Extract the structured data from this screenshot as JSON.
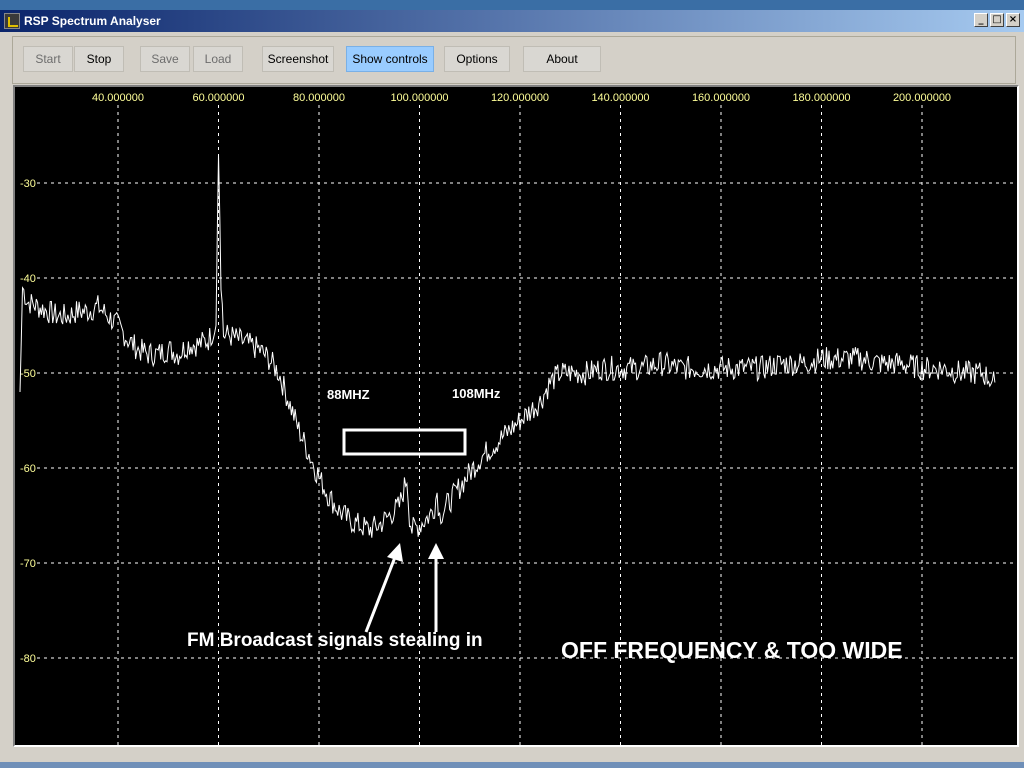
{
  "window": {
    "title": "RSP Spectrum Analyser",
    "controls": [
      "_",
      "□",
      "×"
    ]
  },
  "toolbar": {
    "buttons": [
      {
        "label": "Start",
        "enabled": false
      },
      {
        "label": "Stop",
        "enabled": true
      },
      {
        "label": "Save",
        "enabled": false
      },
      {
        "label": "Load",
        "enabled": false
      },
      {
        "label": "Screenshot",
        "enabled": true
      },
      {
        "label": "Show controls",
        "enabled": true,
        "active": true
      },
      {
        "label": "Options",
        "enabled": true
      },
      {
        "label": "About",
        "enabled": true
      }
    ]
  },
  "colors": {
    "plot_background": "#000000",
    "trace": "#ffffff",
    "axis_labels": "#ffff99",
    "grid": "#ffffff",
    "toolbar_active": "#99ccff"
  },
  "chart_data": {
    "type": "line",
    "title": "",
    "xlabel": "",
    "ylabel": "",
    "xlim": [
      20,
      215
    ],
    "ylim": [
      -90,
      -20
    ],
    "x_ticks": [
      40,
      60,
      80,
      100,
      120,
      140,
      160,
      180,
      200
    ],
    "x_tick_labels": [
      "40.000000",
      "60.000000",
      "80.000000",
      "100.000000",
      "120.000000",
      "140.000000",
      "160.000000",
      "180.000000",
      "200.000000"
    ],
    "y_ticks": [
      -30,
      -40,
      -50,
      -60,
      -70,
      -80
    ],
    "y_tick_labels": [
      "-30",
      "-40",
      "-50",
      "-60",
      "-70",
      "-80"
    ],
    "grid": true,
    "series": [
      {
        "x": [
          20.5,
          21,
          22,
          24,
          26,
          28,
          30,
          32,
          34,
          36,
          38,
          40,
          42,
          44,
          46,
          48,
          50,
          52,
          54,
          56,
          58,
          59.5,
          60,
          60.5,
          61,
          62,
          64,
          66,
          68,
          70,
          72,
          74,
          76,
          78,
          80,
          82,
          84,
          86,
          88,
          90,
          92,
          94,
          96,
          97.5,
          98,
          98.5,
          100,
          102,
          103,
          103.5,
          104,
          106,
          108,
          110,
          112,
          114,
          116,
          118,
          120,
          122,
          124,
          126,
          128,
          130,
          132,
          133,
          133.5,
          136,
          140,
          144,
          148,
          152,
          156,
          160,
          164,
          168,
          172,
          176,
          180,
          184,
          188,
          192,
          196,
          200,
          204,
          208,
          212,
          214.5
        ],
        "values": [
          -52,
          -41,
          -42.5,
          -43,
          -43.5,
          -44,
          -44,
          -43.5,
          -43.5,
          -43,
          -44,
          -45,
          -46.5,
          -47.5,
          -48,
          -48,
          -47.5,
          -48,
          -47,
          -47,
          -46.5,
          -45,
          -27,
          -40,
          -46,
          -46,
          -46.5,
          -47,
          -47.5,
          -48.5,
          -50,
          -53,
          -56,
          -58.5,
          -61,
          -63,
          -64.5,
          -65.5,
          -66,
          -66.5,
          -66,
          -65,
          -64,
          -61,
          -65,
          -66.5,
          -66,
          -65,
          -64,
          -62.5,
          -65,
          -63.5,
          -62,
          -60.5,
          -59,
          -58,
          -57,
          -56,
          -55,
          -54,
          -53,
          -51,
          -50,
          -50,
          -50,
          -50,
          -50,
          -49.5,
          -49.5,
          -49.5,
          -49,
          -49.5,
          -49.5,
          -49.5,
          -49.5,
          -49.5,
          -49,
          -49,
          -48.5,
          -48.5,
          -48.5,
          -49,
          -49,
          -49.5,
          -49.5,
          -50,
          -50,
          -51
        ]
      }
    ],
    "annotations": {
      "label_88": "88MHZ",
      "label_108": "108MHz",
      "fm_text": "FM Broadcast signals stealing in",
      "off_text": "OFF FREQUENCY & TOO WIDE"
    }
  }
}
